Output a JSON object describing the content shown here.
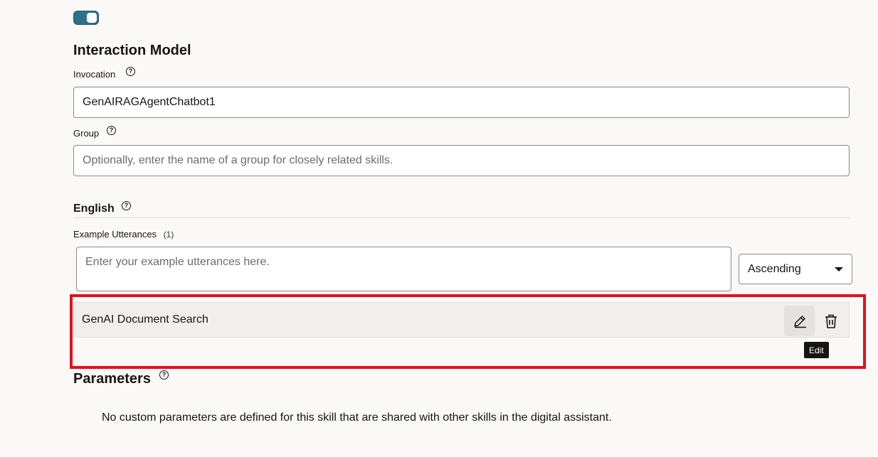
{
  "toggle": {
    "state": "on",
    "color": "#2f7189"
  },
  "interaction_model": {
    "title": "Interaction Model",
    "invocation": {
      "label": "Invocation",
      "value": "GenAIRAGAgentChatbot1"
    },
    "group": {
      "label": "Group",
      "placeholder": "Optionally, enter the name of a group for closely related skills."
    }
  },
  "language": {
    "title": "English",
    "utterances": {
      "label": "Example Utterances",
      "count": "(1)",
      "placeholder": "Enter your example utterances here.",
      "sort_selected": "Ascending",
      "items": [
        {
          "text": "GenAI Document Search"
        }
      ],
      "tooltip": "Edit"
    }
  },
  "parameters": {
    "title": "Parameters",
    "empty_message": "No custom parameters are defined for this skill that are shared with other skills in the digital assistant."
  },
  "colors": {
    "highlight": "#e3101c",
    "accent": "#2f7189",
    "background": "#fbf9f8"
  },
  "icons": {
    "help": "question-circle-icon",
    "edit": "pencil-icon",
    "delete": "trash-icon",
    "dropdown": "caret-down-icon"
  }
}
